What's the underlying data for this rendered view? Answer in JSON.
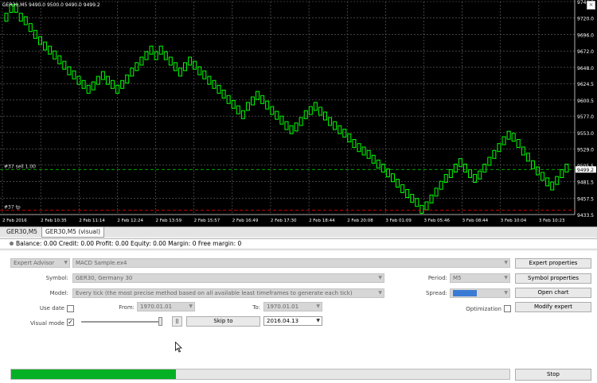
{
  "chart": {
    "symbol_label": "GER30,M5  9490.0 9500.0 9490.0 9499.2",
    "price_labels": [
      "9744.0",
      "9720.0",
      "9696.0",
      "9672.0",
      "9648.0",
      "9624.5",
      "9600.5",
      "9577.0",
      "9553.0",
      "9529.0",
      "9505.5",
      "9481.5",
      "9457.5",
      "9433.5"
    ],
    "current_price": "9499.2",
    "time_labels": [
      "2 Feb 2016",
      "2 Feb 10:35",
      "2 Feb 11:14",
      "2 Feb 12:24",
      "2 Feb 13:59",
      "2 Feb 15:57",
      "2 Feb 16:49",
      "2 Feb 17:30",
      "2 Feb 18:44",
      "2 Feb 20:08",
      "3 Feb 01:09",
      "3 Feb 05:46",
      "3 Feb 08:44",
      "3 Feb 10:04",
      "3 Feb 10:23"
    ],
    "order_line_label": "#37 sell 1.00",
    "tp_line_label": "#37 tp",
    "candle_color": "#00ff00",
    "background": "#000000",
    "order_line_color": "#00c000",
    "tp_line_color": "#ff0000",
    "series": {
      "name": "GER30,M5",
      "y_range": [
        9433.5,
        9744.0
      ],
      "values": [
        9720,
        9733,
        9733,
        9720,
        9715,
        9705,
        9695,
        9686,
        9678,
        9672,
        9665,
        9658,
        9650,
        9642,
        9636,
        9628,
        9622,
        9615,
        9620,
        9628,
        9635,
        9628,
        9622,
        9615,
        9622,
        9630,
        9640,
        9648,
        9656,
        9664,
        9672,
        9664,
        9672,
        9664,
        9656,
        9648,
        9640,
        9648,
        9656,
        9650,
        9642,
        9636,
        9628,
        9622,
        9615,
        9608,
        9600,
        9593,
        9585,
        9578,
        9590,
        9598,
        9606,
        9600,
        9592,
        9584,
        9577,
        9570,
        9562,
        9556,
        9560,
        9568,
        9578,
        9584,
        9590,
        9583,
        9576,
        9568,
        9562,
        9556,
        9551,
        9544,
        9536,
        9530,
        9525,
        9520,
        9513,
        9506,
        9500,
        9493,
        9486,
        9478,
        9470,
        9463,
        9456,
        9450,
        9440,
        9445,
        9455,
        9465,
        9475,
        9485,
        9492,
        9500,
        9508,
        9500,
        9492,
        9485,
        9490,
        9500,
        9510,
        9520,
        9530,
        9540,
        9548,
        9545,
        9536,
        9525,
        9516,
        9505,
        9496,
        9488,
        9480,
        9474,
        9482,
        9492,
        9500
      ]
    }
  },
  "tabs": [
    {
      "label": "GER30,M5"
    },
    {
      "label": "GER30,M5 (visual)"
    }
  ],
  "close_label": "×",
  "account": {
    "text": "Balance: 0.00  Credit: 0.00  Profit: 0.00  Equity: 0.00  Margin: 0  Free margin: 0"
  },
  "tester": {
    "type_value": "Expert Advisor",
    "expert_value": "MACD Sample.ex4",
    "symbol_label": "Symbol:",
    "symbol_value": "GER30, Germany 30",
    "model_label": "Model:",
    "model_value": "Every tick (the most precise method based on all available least timeframes to generate each tick)",
    "use_date_label": "Use date",
    "from_label": "From:",
    "from_value": "1970.01.01",
    "to_label": "To:",
    "to_value": "1970.01.01",
    "visual_mode_label": "Visual mode",
    "visual_mode_checked": "✓",
    "pause_label": "||",
    "skip_to_label": "Skip to",
    "skip_date_value": "2016.04.13",
    "period_label": "Period:",
    "period_value": "M5",
    "spread_label": "Spread:",
    "spread_value": "Current",
    "optimization_label": "Optimization",
    "expert_properties_label": "Expert properties",
    "symbol_properties_label": "Symbol properties",
    "open_chart_label": "Open chart",
    "modify_expert_label": "Modify expert",
    "stop_label": "Stop",
    "progress": 0.33,
    "progress_color": "#06b025",
    "dropdown_arrow": "▼"
  }
}
